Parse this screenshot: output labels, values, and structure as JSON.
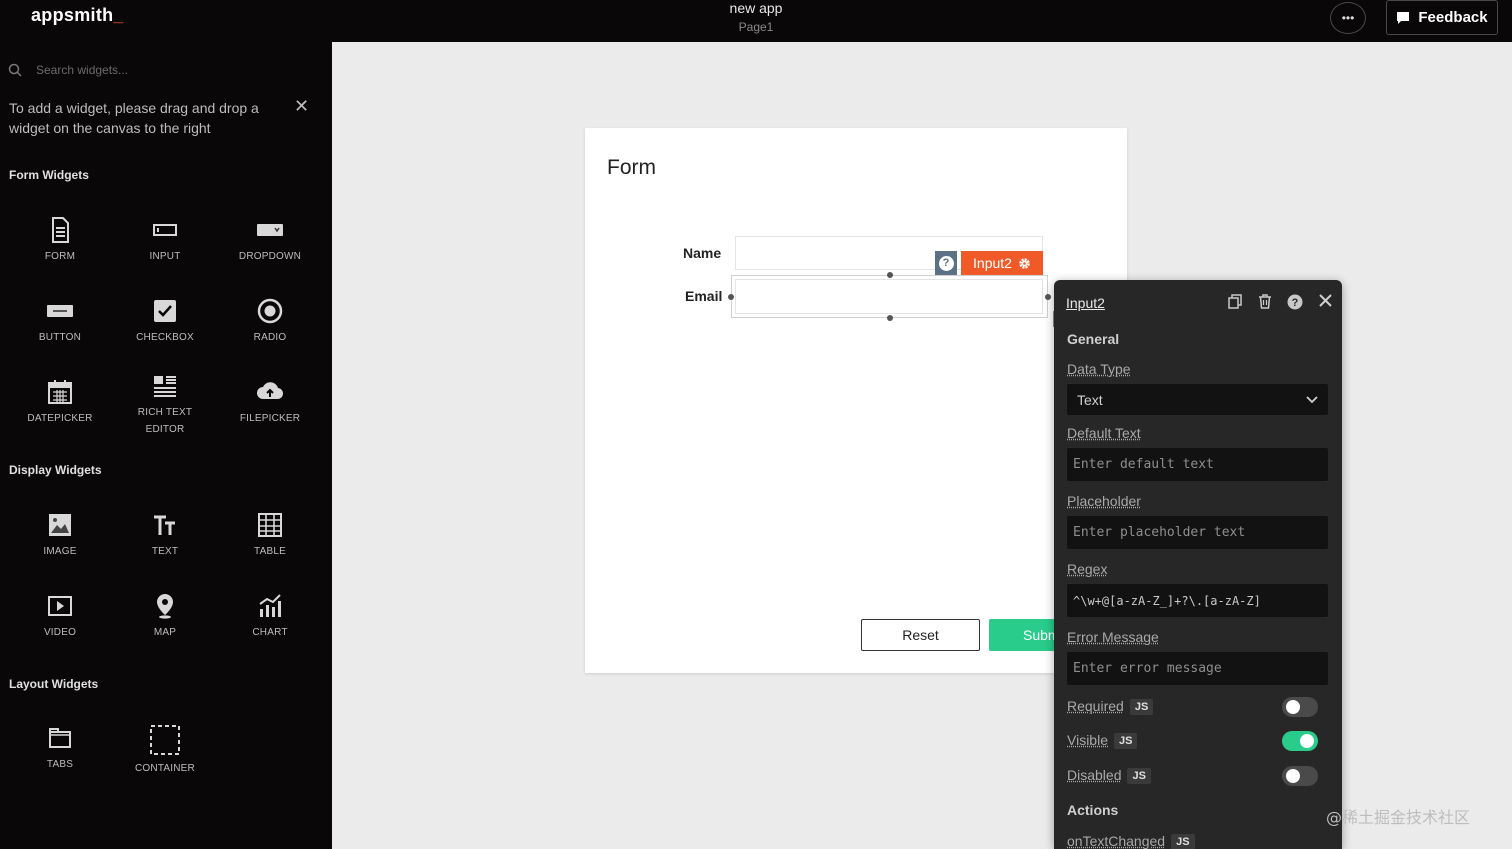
{
  "header": {
    "logo": "appsmith",
    "logo_cursor": "_",
    "app_name": "new app",
    "page_name": "Page1",
    "more_label": "•••",
    "feedback_label": "Feedback"
  },
  "sidebar": {
    "search_placeholder": "Search widgets...",
    "hint": "To add a widget, please drag and drop a widget on the canvas to the right",
    "sections": {
      "form": "Form Widgets",
      "display": "Display Widgets",
      "layout": "Layout Widgets"
    },
    "form_widgets": [
      {
        "label": "FORM",
        "icon": "form-icon"
      },
      {
        "label": "INPUT",
        "icon": "input-icon"
      },
      {
        "label": "DROPDOWN",
        "icon": "dropdown-icon"
      },
      {
        "label": "BUTTON",
        "icon": "button-icon"
      },
      {
        "label": "CHECKBOX",
        "icon": "checkbox-icon"
      },
      {
        "label": "RADIO",
        "icon": "radio-icon"
      },
      {
        "label": "DATEPICKER",
        "icon": "calendar-icon"
      },
      {
        "label": "RICH TEXT EDITOR",
        "icon": "rich-text-icon"
      },
      {
        "label": "FILEPICKER",
        "icon": "cloud-upload-icon"
      }
    ],
    "display_widgets": [
      {
        "label": "IMAGE",
        "icon": "image-icon"
      },
      {
        "label": "TEXT",
        "icon": "text-icon"
      },
      {
        "label": "TABLE",
        "icon": "table-icon"
      },
      {
        "label": "VIDEO",
        "icon": "video-icon"
      },
      {
        "label": "MAP",
        "icon": "map-pin-icon"
      },
      {
        "label": "CHART",
        "icon": "chart-icon"
      }
    ],
    "layout_widgets": [
      {
        "label": "TABS",
        "icon": "tabs-icon"
      },
      {
        "label": "CONTAINER",
        "icon": "container-icon"
      }
    ]
  },
  "canvas": {
    "form_title": "Form",
    "name_label": "Name",
    "email_label": "Email",
    "selected_widget_tag": "Input2",
    "help_badge": "?",
    "reset_label": "Reset",
    "submit_label": "Submit"
  },
  "property_pane": {
    "widget_name": "Input2",
    "general_title": "General",
    "data_type_label": "Data Type",
    "data_type_value": "Text",
    "default_text_label": "Default Text",
    "default_text_placeholder": "Enter default text",
    "placeholder_label": "Placeholder",
    "placeholder_placeholder": "Enter placeholder text",
    "regex_label": "Regex",
    "regex_value": "^\\w+@[a-zA-Z_]+?\\.[a-zA-Z]",
    "error_message_label": "Error Message",
    "error_message_placeholder": "Enter error message",
    "js_badge": "JS",
    "required": {
      "label": "Required",
      "on": false
    },
    "visible": {
      "label": "Visible",
      "on": true
    },
    "disabled": {
      "label": "Disabled",
      "on": false
    },
    "actions_title": "Actions",
    "on_text_changed_label": "onTextChanged"
  },
  "colors": {
    "accent": "#f05a28",
    "success": "#29cc8b",
    "dark_bg": "#090707",
    "pane_bg": "#272727"
  },
  "watermark": "@稀土掘金技术社区"
}
